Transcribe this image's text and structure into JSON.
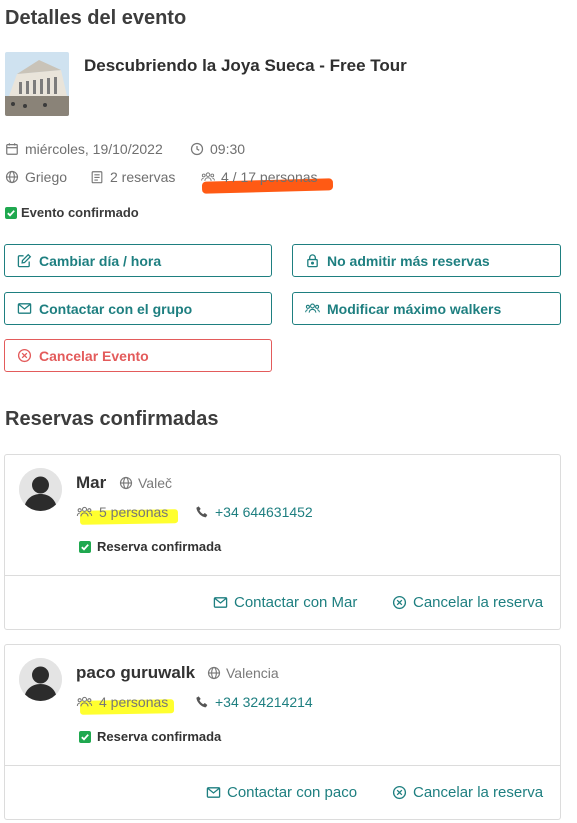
{
  "sections": {
    "details_title": "Detalles del evento",
    "bookings_title": "Reservas confirmadas"
  },
  "event": {
    "name": "Descubriendo la Joya Sueca - Free Tour",
    "date": "miércoles, 19/10/2022",
    "time": "09:30",
    "language": "Griego",
    "bookings": "2 reservas",
    "capacity": "4 / 17 personas",
    "status": "Evento confirmado"
  },
  "actions": {
    "change_date": "Cambiar día / hora",
    "close_bookings": "No admitir más reservas",
    "contact_group": "Contactar con el grupo",
    "modify_max": "Modificar máximo walkers",
    "cancel_event": "Cancelar Evento"
  },
  "bookings": [
    {
      "name": "Mar",
      "city": "Valeč",
      "people": "5 personas",
      "phone": "+34 644631452",
      "status": "Reserva confirmada",
      "contact_label": "Contactar con Mar",
      "cancel_label": "Cancelar la reserva"
    },
    {
      "name": "paco guruwalk",
      "city": "Valencia",
      "people": "4 personas",
      "phone": "+34 324214214",
      "status": "Reserva confirmada",
      "contact_label": "Contactar con paco",
      "cancel_label": "Cancelar la reserva"
    }
  ],
  "colors": {
    "accent": "#1e7f80",
    "danger": "#e35b5b",
    "confirmed": "#1fa84f",
    "highlight_orange": "#ff5a14",
    "highlight_yellow": "#ffff2e"
  },
  "icons": [
    "calendar-icon",
    "clock-icon",
    "globe-icon",
    "clipboard-icon",
    "users-icon",
    "check-icon",
    "edit-icon",
    "lock-icon",
    "envelope-icon",
    "cancel-icon",
    "phone-icon",
    "avatar-icon"
  ]
}
